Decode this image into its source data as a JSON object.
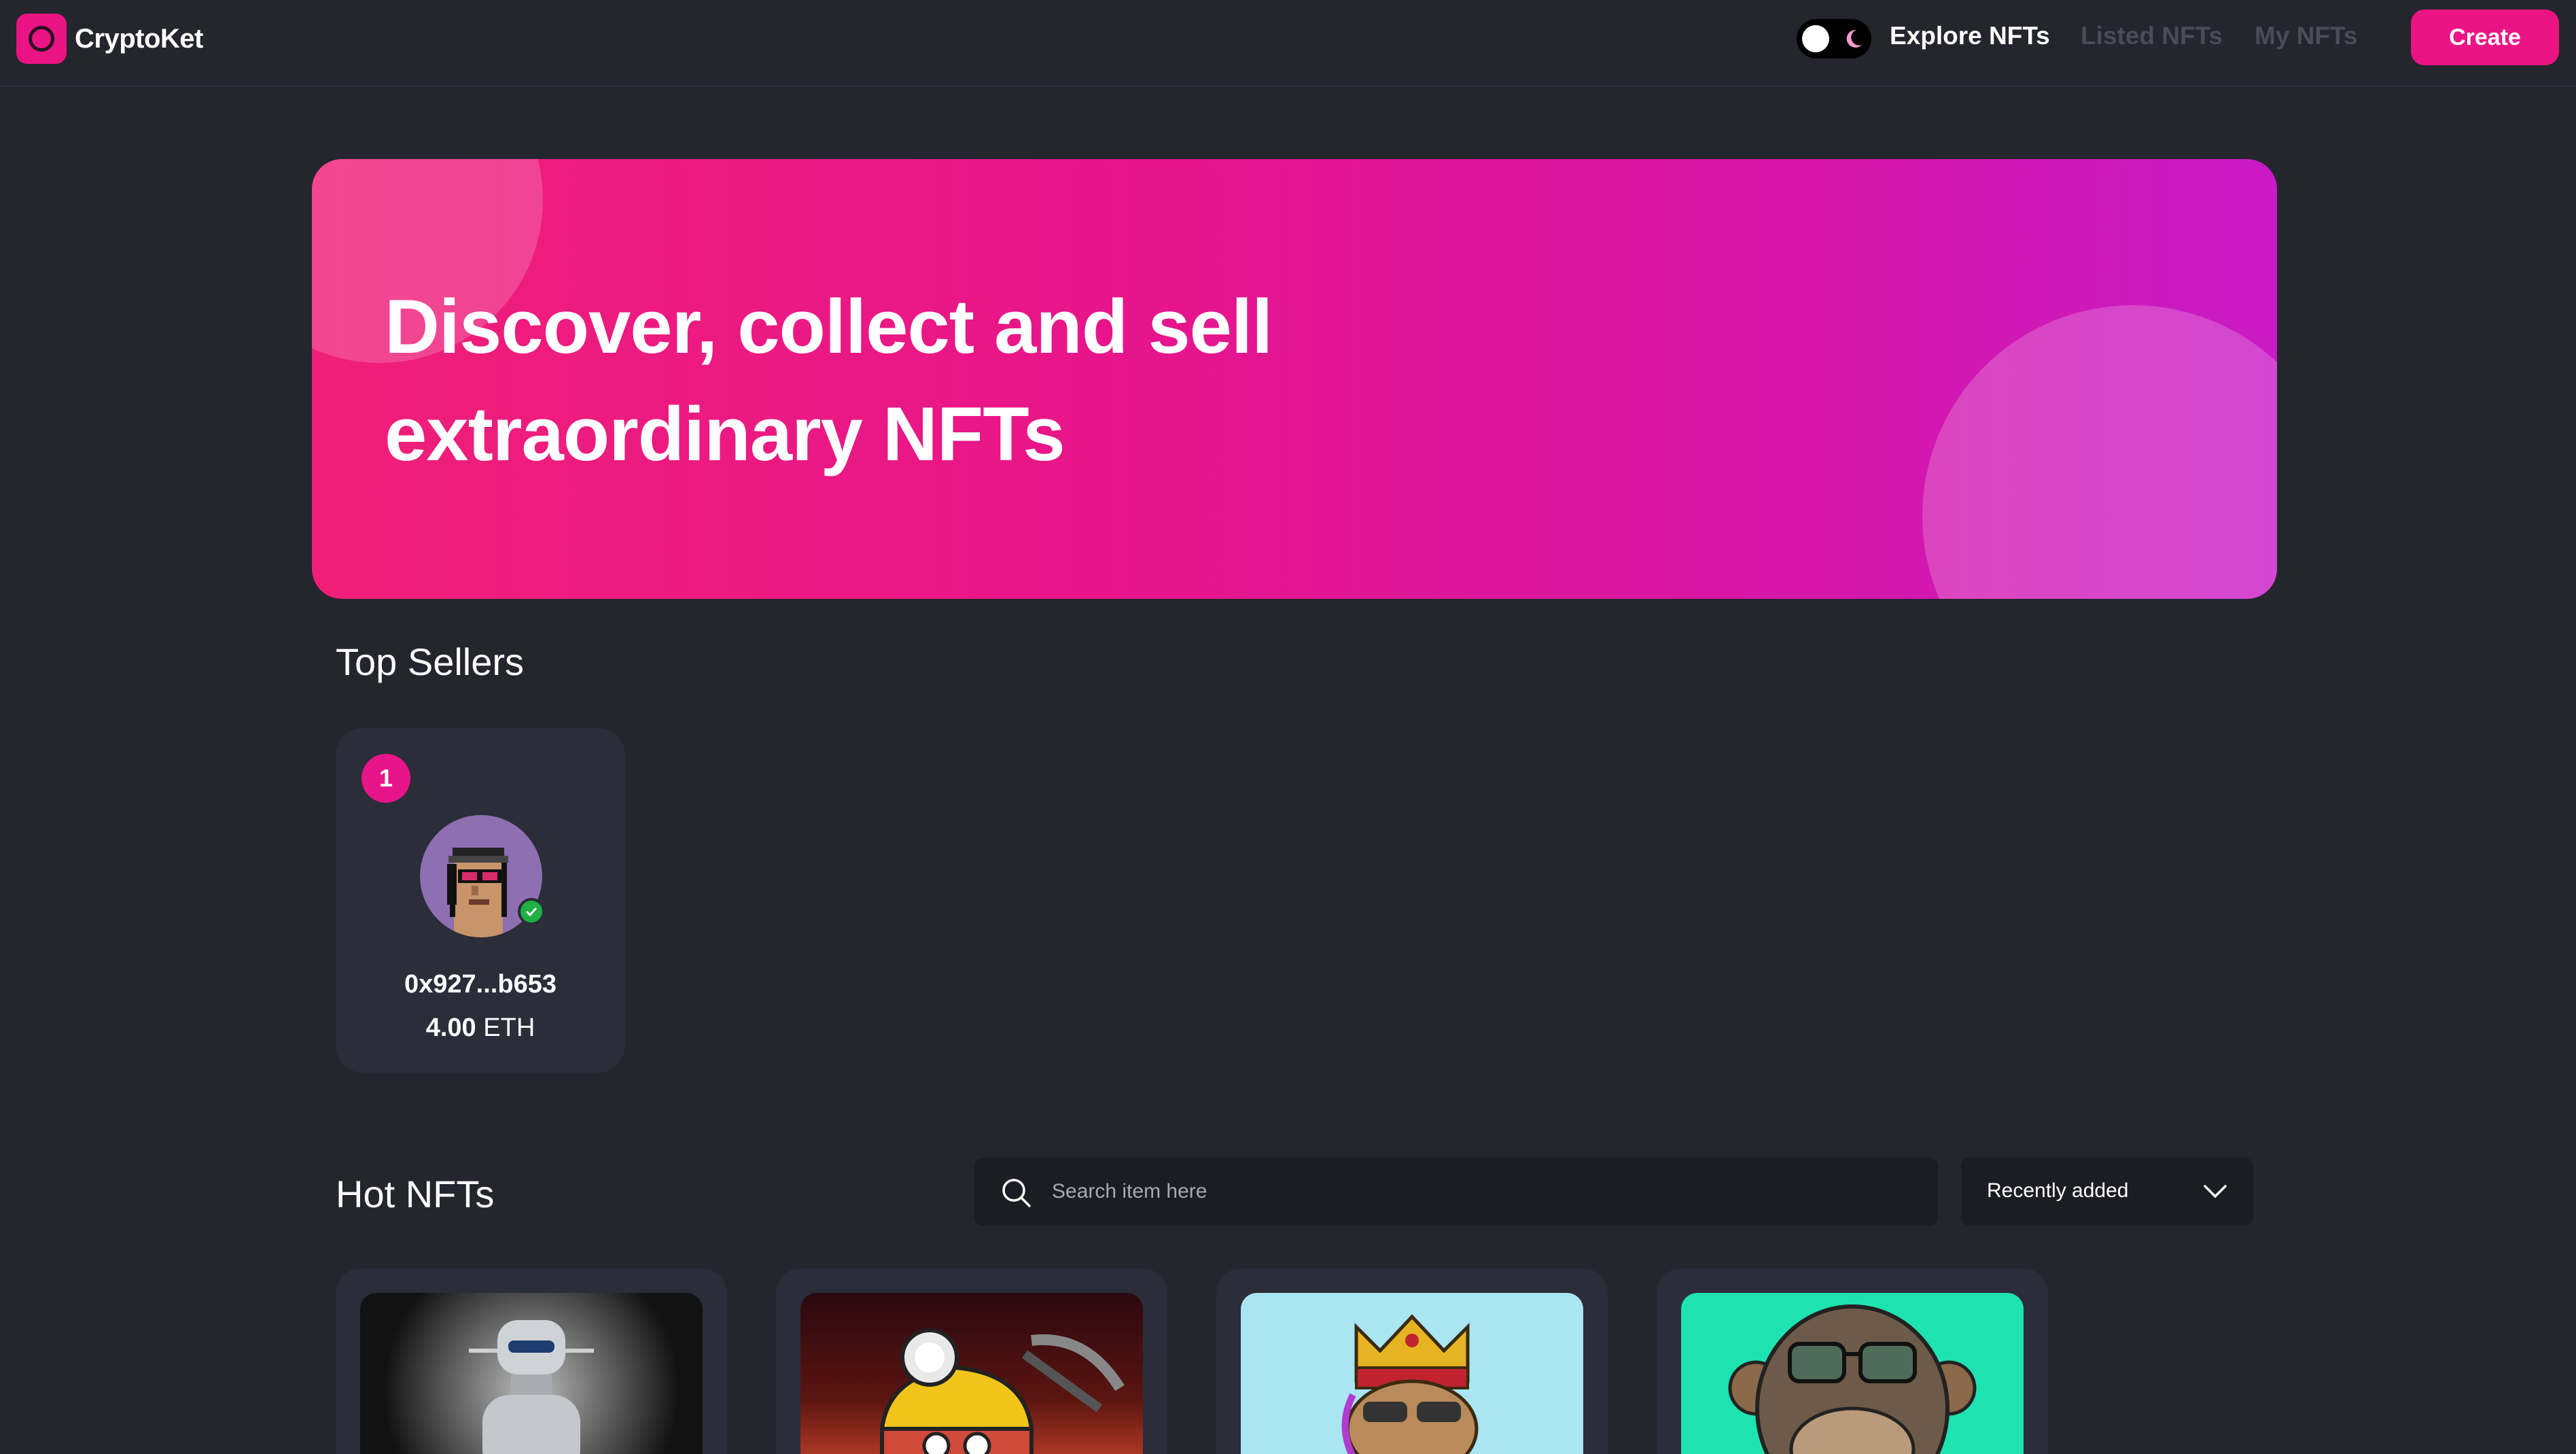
{
  "nav": {
    "brand": "CryptoKet",
    "links": [
      {
        "label": "Explore NFTs",
        "active": true
      },
      {
        "label": "Listed NFTs",
        "active": false
      },
      {
        "label": "My NFTs",
        "active": false
      }
    ],
    "create_label": "Create",
    "theme_toggle": {
      "mode": "dark",
      "icon": "moon-icon"
    }
  },
  "hero": {
    "line1": "Discover, collect and sell",
    "line2": "extraordinary NFTs"
  },
  "top_sellers": {
    "title": "Top Sellers",
    "sellers": [
      {
        "rank": "1",
        "address": "0x927...b653",
        "amount": "4.00",
        "currency": "ETH",
        "verified": true
      }
    ]
  },
  "hot_nfts": {
    "title": "Hot NFTs",
    "search_placeholder": "Search item here",
    "sort_selected": "Recently added",
    "items": [
      {
        "image": "robot"
      },
      {
        "image": "miner"
      },
      {
        "image": "crowned-ape"
      },
      {
        "image": "bored-ape"
      }
    ]
  },
  "colors": {
    "background": "#24252d",
    "card": "#2b2d38",
    "accent": "#eb1484",
    "muted": "#4b4c56"
  }
}
